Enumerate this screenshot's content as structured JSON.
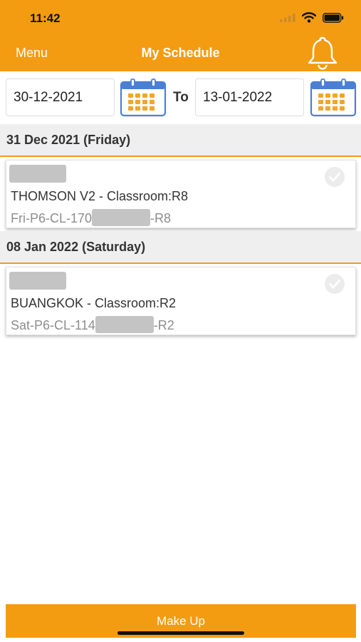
{
  "status_bar": {
    "time": "11:42"
  },
  "nav": {
    "menu_label": "Menu",
    "title": "My Schedule",
    "bell_icon": "bell-icon"
  },
  "date_range": {
    "from": "30-12-2021",
    "to_label": "To",
    "to": "13-01-2022",
    "calendar_icon": "calendar-icon"
  },
  "days": [
    {
      "header": "31 Dec 2021 (Friday)",
      "classes": [
        {
          "location": "THOMSON V2 - Classroom:R8",
          "code_prefix": "Fri-P6-CL-170",
          "code_suffix": "-R8",
          "status_icon": "check-circle-icon"
        }
      ]
    },
    {
      "header": "08 Jan 2022 (Saturday)",
      "classes": [
        {
          "location": "BUANGKOK - Classroom:R2",
          "code_prefix": "Sat-P6-CL-114",
          "code_suffix": "-R2",
          "status_icon": "check-circle-icon"
        }
      ]
    }
  ],
  "footer": {
    "makeup_label": "Make Up"
  },
  "colors": {
    "accent": "#f39c12",
    "calendar_blue": "#4a7fd4",
    "calendar_orange": "#f4a52c"
  }
}
